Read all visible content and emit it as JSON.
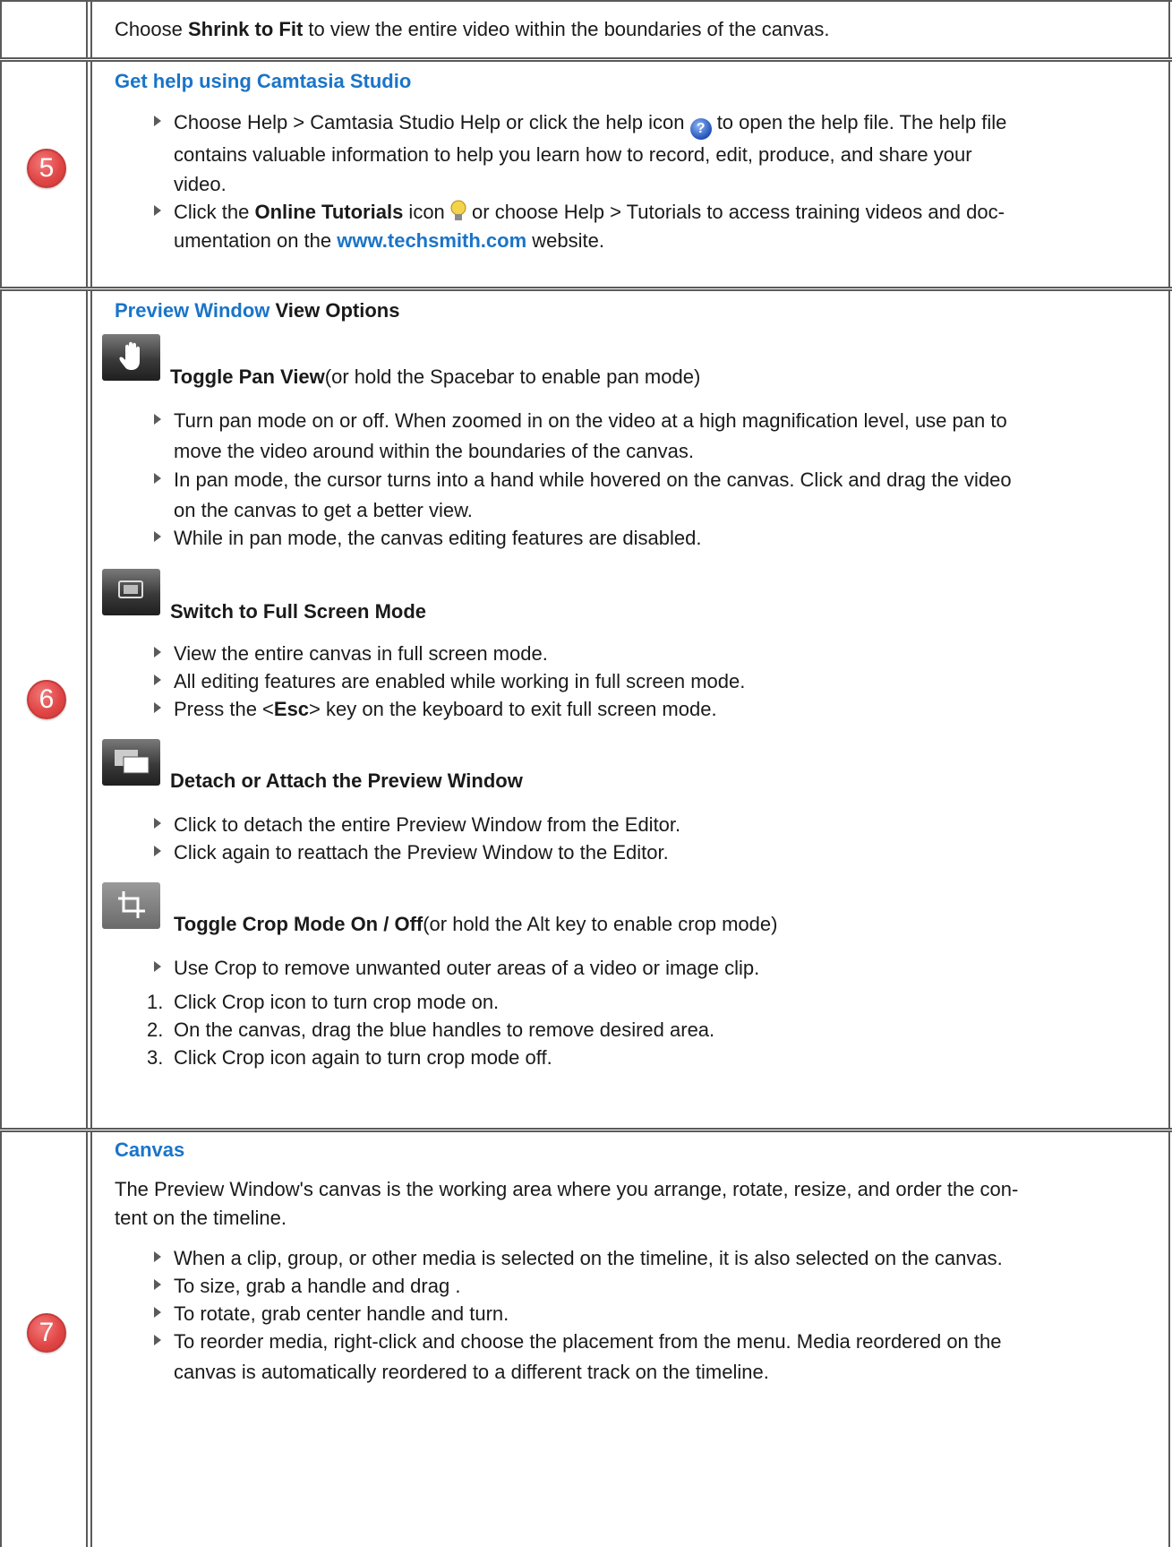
{
  "row4": {
    "prefix": "Choose ",
    "bold": "Shrink to Fit",
    "suffix": " to view the entire video within the boundaries of the canvas."
  },
  "row5": {
    "badge": "5",
    "title": "Get help using Camtasia Studio",
    "b1_l1_a": "Choose Help > Camtasia Studio Help or click the help icon ",
    "b1_l1_b": " to open the help file. The help file",
    "b1_l2": "contains valuable information to help you learn how to record, edit, produce, and share your",
    "b1_l3": "video.",
    "b2_l1_a": "Click the ",
    "b2_l1_bold": "Online Tutorials",
    "b2_l1_b": " icon ",
    "b2_l1_c": " or choose Help > Tutorials to access training videos and doc-",
    "b2_l2_a": "umentation on the ",
    "b2_l2_link": "www.techsmith.com",
    "b2_l2_b": " website."
  },
  "row6": {
    "badge": "6",
    "title_link": "Preview Window",
    "title_rest": " View Options",
    "pan": {
      "bold": "Toggle Pan View",
      "rest": "(or hold the Spacebar to enable pan mode)",
      "b1_l1": "Turn pan mode on or off. When zoomed in on the video at a high magnification level, use pan to",
      "b1_l2": "move the video around within the boundaries of the canvas.",
      "b2_l1": "In pan mode, the cursor turns into a hand while hovered on the canvas. Click and drag the video",
      "b2_l2": "on the canvas to get a better view.",
      "b3": "While in pan mode, the canvas editing features are disabled."
    },
    "full": {
      "bold": "Switch to Full Screen Mode",
      "b1": "View the entire canvas in full screen mode.",
      "b2": "All editing features are enabled while working in full screen mode.",
      "b3_a": "Press the <",
      "b3_bold": "Esc",
      "b3_b": "> key on the keyboard to exit full screen mode."
    },
    "detach": {
      "bold": "Detach or Attach the Preview Window",
      "b1": "Click to detach the entire Preview Window from the Editor.",
      "b2": "Click again to reattach the Preview Window to the Editor."
    },
    "crop": {
      "bold": "Toggle Crop Mode On / Off",
      "rest": "(or hold the Alt key to enable crop mode)",
      "b1": "Use Crop to remove unwanted outer areas of a video or image clip.",
      "n1_num": "1.",
      "n1": "Click Crop icon to turn crop mode on.",
      "n2_num": "2.",
      "n2": "On the canvas, drag the blue handles to remove desired area.",
      "n3_num": "3.",
      "n3": "Click Crop icon again to turn crop mode off."
    }
  },
  "row7": {
    "badge": "7",
    "title": "Canvas",
    "p_l1": "The Preview Window's canvas is the working area where you arrange, rotate, resize, and order the con-",
    "p_l2": "tent on the timeline.",
    "b1": "When a clip, group, or other media is selected on the timeline, it is also selected on the canvas.",
    "b2": "To size, grab a handle and drag .",
    "b3": "To rotate, grab center handle and turn.",
    "b4_l1": "To reorder media, right-click and choose the placement from the menu. Media reordered on the",
    "b4_l2": "canvas is automatically reordered to a different track on the timeline."
  }
}
